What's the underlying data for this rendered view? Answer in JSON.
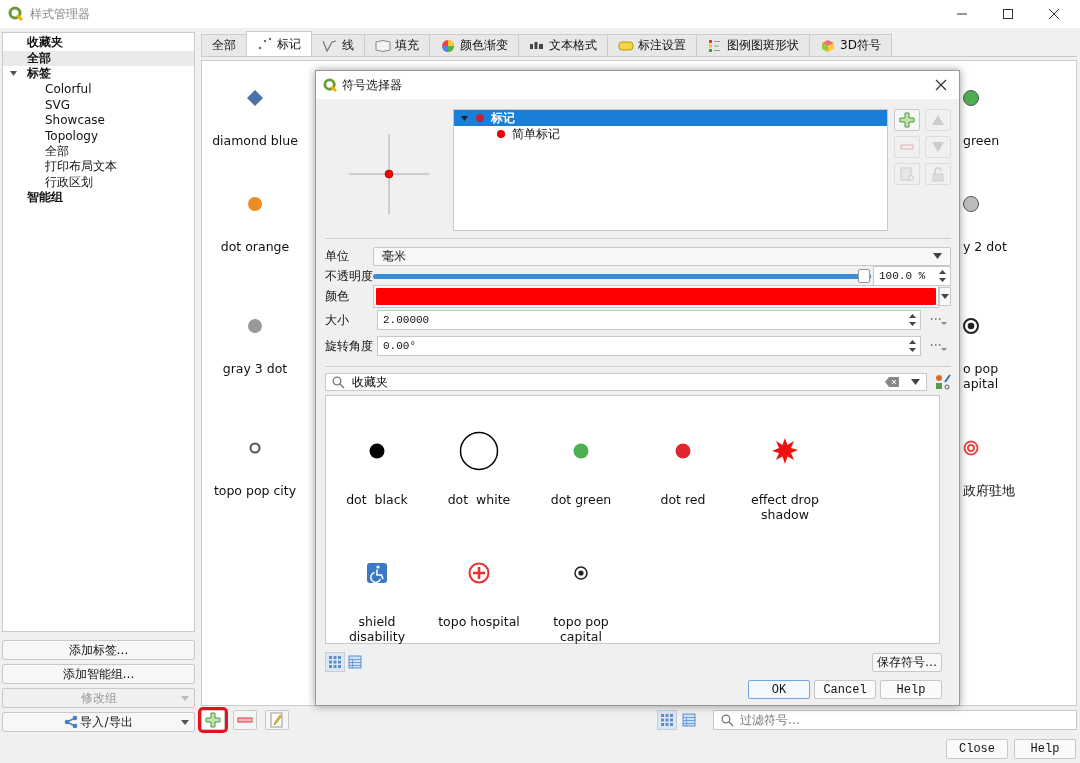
{
  "window": {
    "title": "样式管理器"
  },
  "sidebar": {
    "items": [
      {
        "label": "收藏夹",
        "selected": false
      },
      {
        "label": "全部",
        "selected": true
      },
      {
        "label": "标签",
        "selected": false,
        "expanded": true,
        "children": [
          {
            "label": "Colorful"
          },
          {
            "label": "SVG"
          },
          {
            "label": "Showcase"
          },
          {
            "label": "Topology"
          },
          {
            "label": "全部"
          },
          {
            "label": "打印布局文本"
          },
          {
            "label": "行政区划"
          }
        ]
      },
      {
        "label": "智能组",
        "selected": false
      }
    ],
    "buttons": [
      {
        "label": "添加标签…",
        "disabled": false,
        "dropdown": false
      },
      {
        "label": "添加智能组…",
        "disabled": false,
        "dropdown": false
      },
      {
        "label": "修改组",
        "disabled": true,
        "dropdown": true
      },
      {
        "label": "导入/导出",
        "disabled": false,
        "dropdown": true
      }
    ]
  },
  "tabs": [
    {
      "label": "全部",
      "selected": false
    },
    {
      "label": "标记",
      "selected": true
    },
    {
      "label": "线",
      "selected": false
    },
    {
      "label": "填充",
      "selected": false
    },
    {
      "label": "颜色渐变",
      "selected": false
    },
    {
      "label": "文本格式",
      "selected": false
    },
    {
      "label": "标注设置",
      "selected": false
    },
    {
      "label": "图例图斑形状",
      "selected": false
    },
    {
      "label": "3D符号",
      "selected": false
    }
  ],
  "symbols_left": [
    {
      "name": "diamond blue",
      "kind": "diamond",
      "color": "#4a72a8"
    },
    {
      "name": "dot orange",
      "kind": "dot",
      "color": "#f08a24"
    },
    {
      "name": "gray 3 dot",
      "kind": "dot",
      "color": "#9a9a9a"
    },
    {
      "name": "topo pop city",
      "kind": "ring",
      "color": "#555555"
    }
  ],
  "symbols_right": [
    {
      "name": "green",
      "kind": "dot",
      "color": "#4caf50"
    },
    {
      "name": "y 2 dot",
      "kind": "dot",
      "color": "#bdbdbd"
    },
    {
      "name": "o pop apital",
      "kind": "dotring",
      "color": "#222222"
    },
    {
      "name": "政府驻地",
      "kind": "target",
      "color": "#e84a4a"
    }
  ],
  "toolbar": [
    {
      "kind": "add",
      "highlighted": true
    },
    {
      "kind": "remove",
      "highlighted": false
    },
    {
      "kind": "edit",
      "highlighted": false
    }
  ],
  "view_toggles": [
    {
      "kind": "icons",
      "selected": true
    },
    {
      "kind": "list",
      "selected": false
    }
  ],
  "filter": {
    "placeholder": "过滤符号…"
  },
  "footer_buttons": [
    "Close",
    "Help"
  ],
  "dialog": {
    "title": "符号选择器",
    "tree": {
      "label": "标记",
      "selected": true,
      "expanded": true,
      "children": [
        {
          "label": "简单标记",
          "selected": false
        }
      ]
    },
    "layer_buttons": [
      {
        "kind": "add",
        "disabled": false
      },
      {
        "kind": "up",
        "disabled": true
      },
      {
        "kind": "remove",
        "disabled": true
      },
      {
        "kind": "down",
        "disabled": true
      },
      {
        "kind": "duplicate",
        "disabled": true
      },
      {
        "kind": "lock",
        "disabled": true
      }
    ],
    "properties": [
      {
        "label": "单位",
        "kind": "combo",
        "value": "毫米"
      },
      {
        "label": "不透明度",
        "kind": "slider",
        "level": 1,
        "value": "100.0 %"
      },
      {
        "label": "颜色",
        "kind": "color",
        "color": "#ff0000"
      },
      {
        "label": "大小",
        "kind": "spin",
        "value": "2.00000"
      },
      {
        "label": "旋转角度",
        "kind": "spin",
        "value": "0.00°"
      }
    ],
    "search": {
      "value": "收藏夹"
    },
    "symbols": [
      {
        "name": "dot  black",
        "kind": "dot",
        "color": "#000000"
      },
      {
        "name": "dot  white",
        "kind": "bigring",
        "color": "#000000"
      },
      {
        "name": "dot green",
        "kind": "dot",
        "color": "#4caf50"
      },
      {
        "name": "dot red",
        "kind": "dot",
        "color": "#e0262e"
      },
      {
        "name": "effect drop shadow",
        "kind": "star",
        "color": "#ee1111"
      },
      {
        "name": "shield disability",
        "kind": "shield",
        "color": "#3d78c2"
      },
      {
        "name": "topo hospital",
        "kind": "hospital",
        "color": "#e83030"
      },
      {
        "name": "topo pop capital",
        "kind": "dotring",
        "color": "#222222"
      }
    ],
    "view_toggles": [
      {
        "kind": "icons",
        "selected": true
      },
      {
        "kind": "list",
        "selected": false
      }
    ],
    "save_button": "保存符号…",
    "buttons": [
      {
        "label": "OK",
        "default": true
      },
      {
        "label": "Cancel",
        "default": false
      },
      {
        "label": "Help",
        "default": false
      }
    ]
  }
}
